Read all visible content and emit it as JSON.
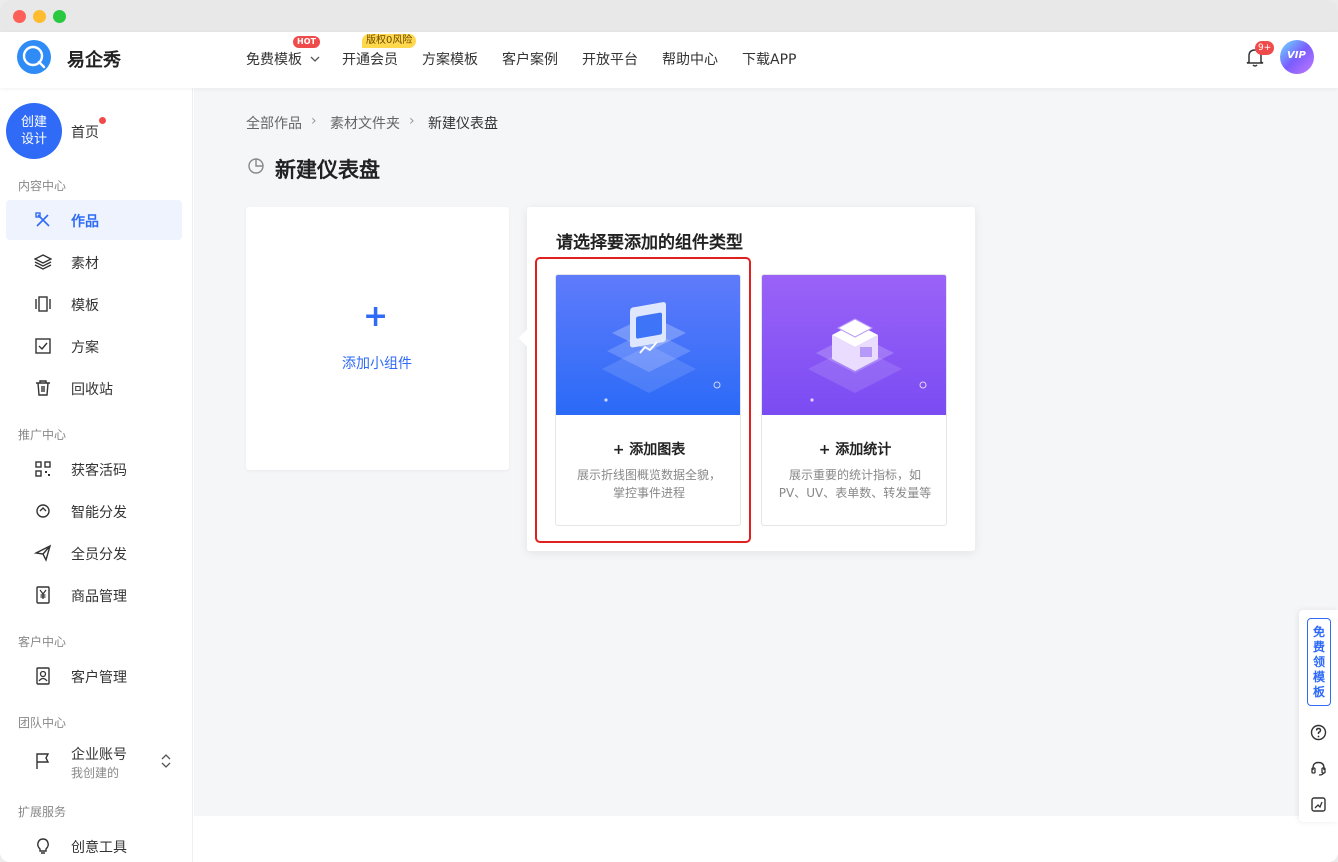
{
  "app": {
    "name": "易企秀"
  },
  "topnav": {
    "items": [
      {
        "label": "免费模板"
      },
      {
        "label": "开通会员"
      },
      {
        "label": "方案模板"
      },
      {
        "label": "客户案例"
      },
      {
        "label": "开放平台"
      },
      {
        "label": "帮助中心"
      },
      {
        "label": "下载APP"
      }
    ],
    "hot_badge": "HOT",
    "vip_badge": "版权0风险",
    "notification_count": "9+",
    "avatar_text": "VIP"
  },
  "sidebar": {
    "create_label_1": "创建",
    "create_label_2": "设计",
    "home": "首页",
    "sections": {
      "content": "内容中心",
      "promo": "推广中心",
      "customer": "客户中心",
      "team": "团队中心",
      "extend": "扩展服务"
    },
    "items": {
      "works": "作品",
      "materials": "素材",
      "templates": "模板",
      "plans": "方案",
      "recycle": "回收站",
      "qrcode": "获客活码",
      "smart_share": "智能分发",
      "all_share": "全员分发",
      "goods": "商品管理",
      "crm": "客户管理",
      "enterprise": "企业账号",
      "enterprise_sub": "我创建的",
      "creative": "创意工具"
    }
  },
  "breadcrumb": [
    "全部作品",
    "素材文件夹",
    "新建仪表盘"
  ],
  "page_title": "新建仪表盘",
  "add_widget": {
    "plus": "+",
    "label": "添加小组件"
  },
  "popover": {
    "title": "请选择要添加的组件类型",
    "options": [
      {
        "title": "+ 添加图表",
        "desc": "展示折线图概览数据全貌，掌控事件进程"
      },
      {
        "title": "+ 添加统计",
        "desc": "展示重要的统计指标，如PV、UV、表单数、转发量等"
      }
    ]
  },
  "float_bar": {
    "template_label": "免费领模板"
  }
}
